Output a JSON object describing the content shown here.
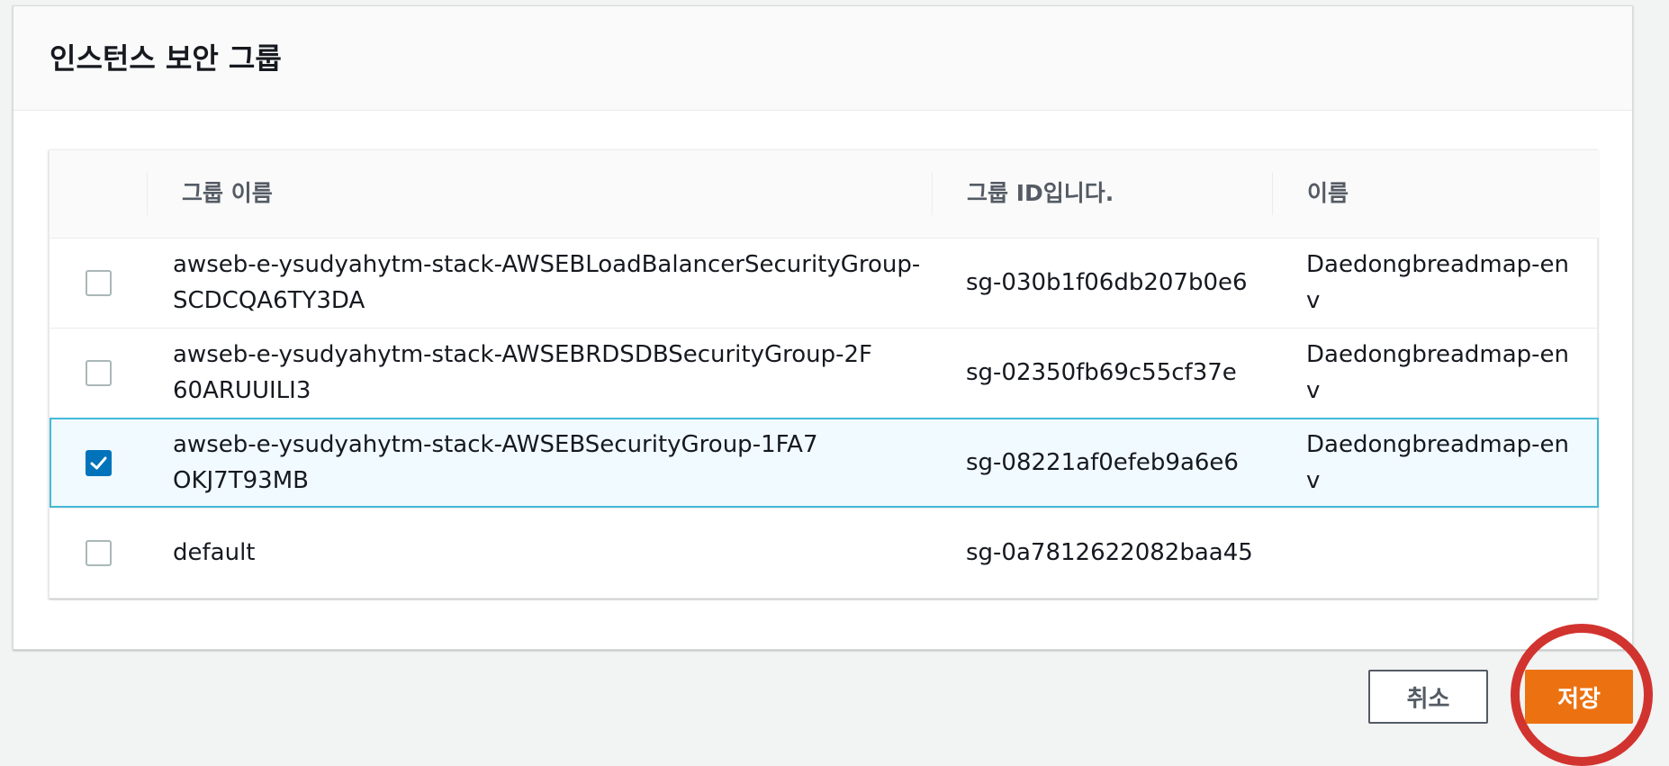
{
  "panel": {
    "title": "인스턴스 보안 그룹"
  },
  "table": {
    "headers": {
      "group_name": "그룹 이름",
      "group_id": "그룹 ID입니다.",
      "name": "이름"
    },
    "rows": [
      {
        "checked": false,
        "group_name": "awseb-e-ysudyahytm-stack-AWSEBLoadBalancerSecurityGroup-SCDCQA6TY3DA",
        "group_id": "sg-030b1f06db207b0e6",
        "name": "Daedongbreadmap-env"
      },
      {
        "checked": false,
        "group_name": "awseb-e-ysudyahytm-stack-AWSEBRDSDBSecurityGroup-2F60ARUUILI3",
        "group_id": "sg-02350fb69c55cf37e",
        "name": "Daedongbreadmap-env"
      },
      {
        "checked": true,
        "group_name": "awseb-e-ysudyahytm-stack-AWSEBSecurityGroup-1FA7OKJ7T93MB",
        "group_id": "sg-08221af0efeb9a6e6",
        "name": "Daedongbreadmap-env"
      },
      {
        "checked": false,
        "group_name": "default",
        "group_id": "sg-0a7812622082baa45",
        "name": ""
      }
    ]
  },
  "footer": {
    "cancel_label": "취소",
    "save_label": "저장"
  },
  "colors": {
    "accent": "#0073bb",
    "save_button": "#ec7211",
    "highlight_ring": "#d1342f",
    "selected_row": "#f1faff"
  }
}
